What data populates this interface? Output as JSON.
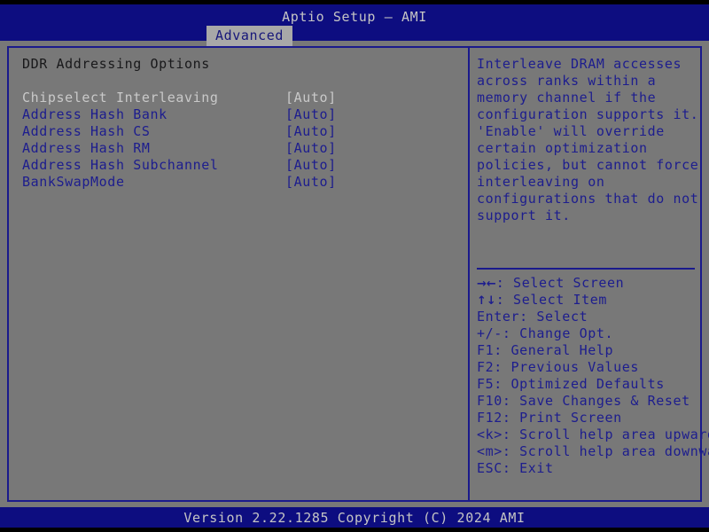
{
  "header": {
    "title": "Aptio Setup – AMI",
    "tabs": [
      {
        "label": "Advanced",
        "active": true
      }
    ]
  },
  "main": {
    "section_title": "DDR Addressing Options",
    "options": [
      {
        "label": "Chipselect Interleaving",
        "value": "[Auto]",
        "selected": true
      },
      {
        "label": "Address Hash Bank",
        "value": "[Auto]",
        "selected": false
      },
      {
        "label": "Address Hash CS",
        "value": "[Auto]",
        "selected": false
      },
      {
        "label": "Address Hash RM",
        "value": "[Auto]",
        "selected": false
      },
      {
        "label": "Address Hash Subchannel",
        "value": "[Auto]",
        "selected": false
      },
      {
        "label": "BankSwapMode",
        "value": "[Auto]",
        "selected": false
      }
    ]
  },
  "help": {
    "text": "Interleave DRAM accesses across ranks within a memory channel if the configuration supports it. 'Enable' will override certain optimization policies, but cannot force interleaving on configurations that do not support it.",
    "legend": [
      {
        "key": "→←",
        "key_is_glyph": true,
        "text": ": Select Screen"
      },
      {
        "key": "↑↓",
        "key_is_glyph": true,
        "text": ": Select Item"
      },
      {
        "key": "Enter",
        "key_is_glyph": false,
        "text": ": Select"
      },
      {
        "key": "+/-",
        "key_is_glyph": false,
        "text": ": Change Opt."
      },
      {
        "key": "F1",
        "key_is_glyph": false,
        "text": ": General Help"
      },
      {
        "key": "F2",
        "key_is_glyph": false,
        "text": ": Previous Values"
      },
      {
        "key": "F5",
        "key_is_glyph": false,
        "text": ": Optimized Defaults"
      },
      {
        "key": "F10",
        "key_is_glyph": false,
        "text": ": Save Changes & Reset"
      },
      {
        "key": "F12",
        "key_is_glyph": false,
        "text": ": Print Screen"
      },
      {
        "key": "<k>",
        "key_is_glyph": false,
        "text": ": Scroll help area upwards"
      },
      {
        "key": "<m>",
        "key_is_glyph": false,
        "text": ": Scroll help area downwards"
      },
      {
        "key": "ESC",
        "key_is_glyph": false,
        "text": ": Exit"
      }
    ]
  },
  "footer": {
    "version_text": "Version 2.22.1285 Copyright (C) 2024 AMI"
  },
  "colors": {
    "background": "#787878",
    "header_blue": "#0d0d80",
    "border_blue": "#1a1a8c",
    "text_blue": "#1d1d8e",
    "text_light": "#c4c4c4",
    "tab_active_bg": "#a8a8a8",
    "section_title": "#19191b"
  }
}
